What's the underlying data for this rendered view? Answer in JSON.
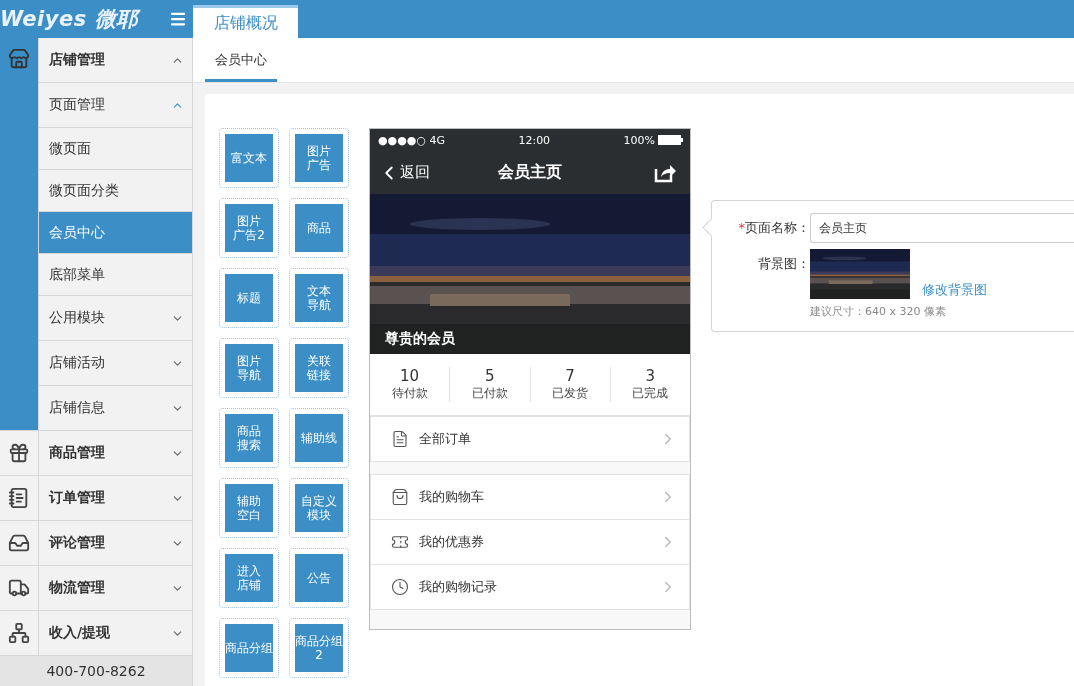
{
  "header": {
    "logo": "Weiyes 微耶"
  },
  "tabs": [
    {
      "label": "店铺概况",
      "selected": true
    }
  ],
  "subtabs": [
    {
      "label": "会员中心",
      "selected": true
    }
  ],
  "sidebar": {
    "groups": [
      {
        "label": "店铺管理",
        "expanded": true,
        "children": [
          {
            "label": "页面管理",
            "expanded": true,
            "children": [
              {
                "label": "微页面",
                "selected": false
              },
              {
                "label": "微页面分类",
                "selected": false
              },
              {
                "label": "会员中心",
                "selected": true
              },
              {
                "label": "底部菜单",
                "selected": false
              }
            ]
          },
          {
            "label": "公用模块",
            "expanded": false
          },
          {
            "label": "店铺活动",
            "expanded": false
          },
          {
            "label": "店铺信息",
            "expanded": false
          }
        ]
      },
      {
        "label": "商品管理",
        "expanded": false
      },
      {
        "label": "订单管理",
        "expanded": false
      },
      {
        "label": "评论管理",
        "expanded": false
      },
      {
        "label": "物流管理",
        "expanded": false
      },
      {
        "label": "收入/提现",
        "expanded": false
      }
    ],
    "phone": "400-700-8262"
  },
  "widgets": [
    {
      "lines": [
        "富文本"
      ]
    },
    {
      "lines": [
        "图片",
        "广告"
      ]
    },
    {
      "lines": [
        "图片",
        "广告2"
      ]
    },
    {
      "lines": [
        "商品"
      ]
    },
    {
      "lines": [
        "标题"
      ]
    },
    {
      "lines": [
        "文本",
        "导航"
      ]
    },
    {
      "lines": [
        "图片",
        "导航"
      ]
    },
    {
      "lines": [
        "关联",
        "链接"
      ]
    },
    {
      "lines": [
        "商品",
        "搜索"
      ]
    },
    {
      "lines": [
        "辅助线"
      ]
    },
    {
      "lines": [
        "辅助",
        "空白"
      ]
    },
    {
      "lines": [
        "自定义",
        "模块"
      ]
    },
    {
      "lines": [
        "进入",
        "店铺"
      ]
    },
    {
      "lines": [
        "公告"
      ]
    },
    {
      "lines": [
        "商品分组"
      ]
    },
    {
      "lines": [
        "商品分组",
        "2"
      ]
    }
  ],
  "preview": {
    "status_bar": {
      "signal": "●●●●○ 4G",
      "time": "12:00",
      "battery": "100%"
    },
    "nav": {
      "back": "返回",
      "title": "会员主页"
    },
    "banner": {
      "kind": "picture",
      "caption": "尊贵的会员"
    },
    "stats": [
      {
        "value": "10",
        "label": "待付款"
      },
      {
        "value": "5",
        "label": "已付款"
      },
      {
        "value": "7",
        "label": "已发货"
      },
      {
        "value": "3",
        "label": "已完成"
      }
    ],
    "sections": [
      [
        {
          "label": "全部订单"
        }
      ],
      [
        {
          "label": "我的购物车"
        },
        {
          "label": "我的优惠券"
        },
        {
          "label": "我的购物记录"
        }
      ]
    ]
  },
  "form": {
    "name_field": {
      "required_mark": "*",
      "label": "页面名称：",
      "value": "会员主页"
    },
    "background": {
      "label": "背景图：",
      "kind": "picture",
      "link": "修改背景图",
      "hint": "建议尺寸：640 x 320 像素"
    }
  }
}
